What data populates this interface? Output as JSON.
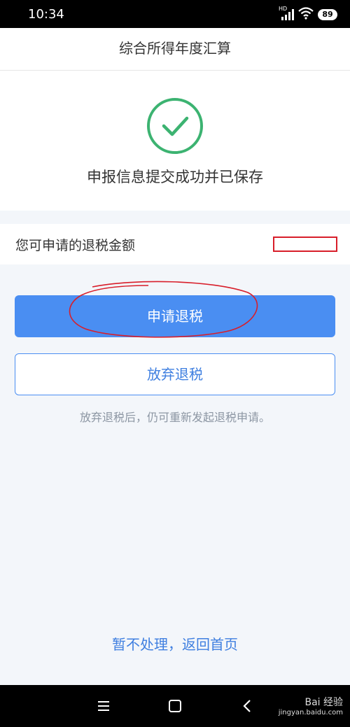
{
  "status": {
    "time": "10:34",
    "network": "HD",
    "battery": "89"
  },
  "header": {
    "title": "综合所得年度汇算"
  },
  "result": {
    "icon": "check-circle-icon",
    "message": "申报信息提交成功并已保存",
    "success_color": "#3cb371"
  },
  "refund": {
    "label": "您可申请的退税金额",
    "amount": ""
  },
  "actions": {
    "apply_label": "申请退税",
    "abandon_label": "放弃退税",
    "hint": "放弃退税后，仍可重新发起退税申请。",
    "back_home_label": "暂不处理，返回首页",
    "accent_color": "#4a8ef2"
  },
  "system_nav": {
    "menu_icon": "menu-icon",
    "home_icon": "home-icon",
    "back_icon": "back-icon"
  },
  "watermark": {
    "logo_text": "Bai 经验",
    "url": "jingyan.baidu.com"
  }
}
